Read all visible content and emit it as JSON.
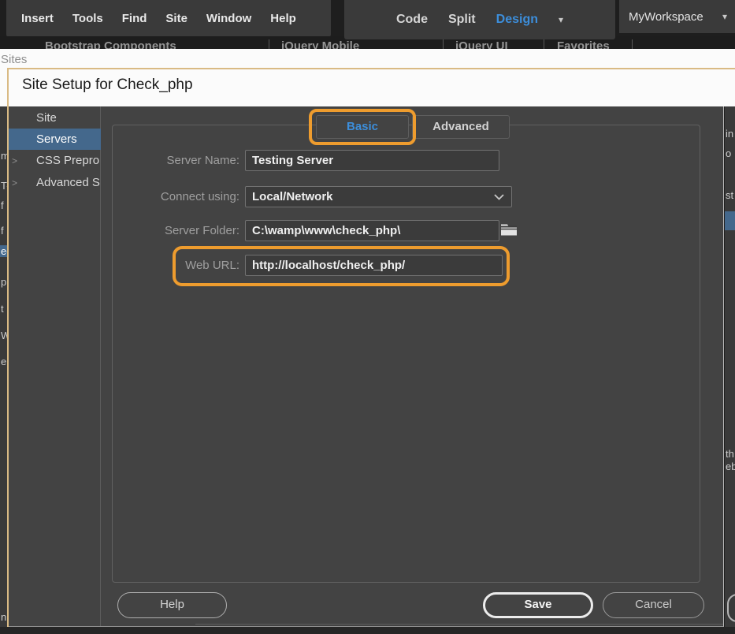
{
  "app": {
    "menu_items": [
      "Insert",
      "Tools",
      "Find",
      "Site",
      "Window",
      "Help"
    ],
    "view_modes": {
      "code": "Code",
      "split": "Split",
      "design": "Design"
    },
    "workspace": "MyWorkspace",
    "insert_tabs": [
      "Bootstrap Components",
      "jQuery Mobile",
      "jQuery UI",
      "Favorites"
    ]
  },
  "manage_sites": {
    "header": "Sites"
  },
  "dialog": {
    "title": "Site Setup for Check_php",
    "sidebar": [
      {
        "label": "Site"
      },
      {
        "label": "Servers"
      },
      {
        "label": "CSS Prepro"
      },
      {
        "label": "Advanced S"
      }
    ],
    "tabs": {
      "basic": "Basic",
      "advanced": "Advanced"
    },
    "fields": {
      "server_name": {
        "label": "Server Name:",
        "value": "Testing Server"
      },
      "connect_using": {
        "label": "Connect using:",
        "value": "Local/Network"
      },
      "server_folder": {
        "label": "Server Folder:",
        "value": "C:\\wamp\\www\\check_php\\"
      },
      "web_url": {
        "label": "Web URL:",
        "value": "http://localhost/check_php/"
      }
    },
    "buttons": {
      "help": "Help",
      "save": "Save",
      "cancel": "Cancel"
    }
  },
  "colors": {
    "annotation_orange": "#ee9c2e",
    "accent_blue": "#3c8edb",
    "selection_blue": "#44688c",
    "dialog_border_tan": "#d9ba84"
  },
  "background_fragments": {
    "left": [
      "m",
      "T-",
      "f",
      "f",
      "ec",
      "p",
      "t",
      "W",
      "e",
      "n"
    ],
    "right": [
      "in",
      "o",
      "st",
      "th",
      "eb"
    ]
  }
}
